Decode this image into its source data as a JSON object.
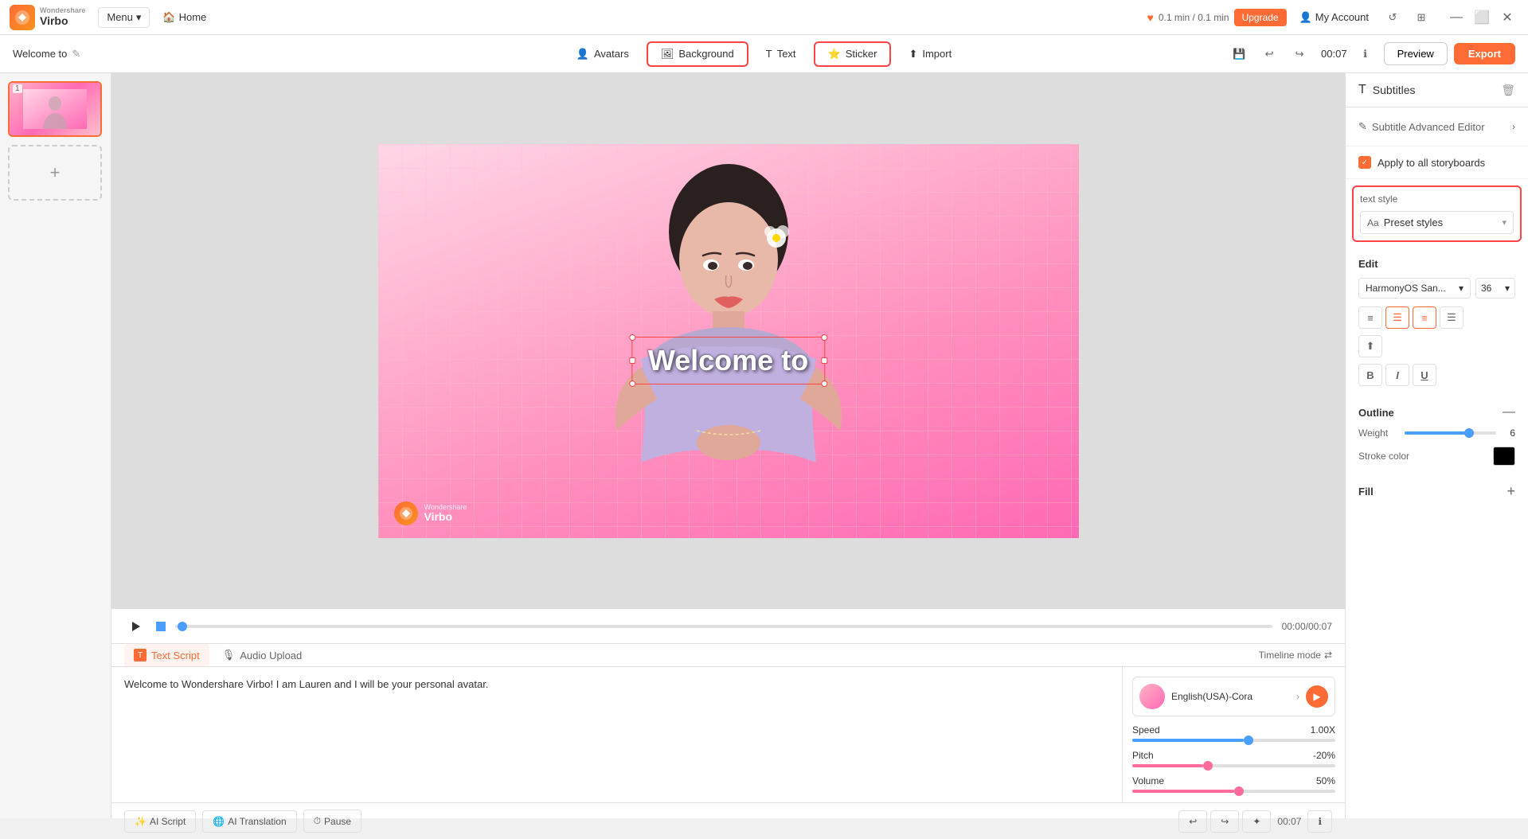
{
  "app": {
    "logo_text": "Virbo",
    "logo_brand": "Wondershare"
  },
  "topbar": {
    "menu_label": "Menu",
    "home_label": "Home",
    "timer_text": "0.1 min / 0.1 min",
    "upgrade_label": "Upgrade",
    "account_label": "My Account",
    "time_display": "00:07"
  },
  "page_title": "Welcome to",
  "toolbar": {
    "avatars_label": "Avatars",
    "background_label": "Background",
    "text_label": "Text",
    "sticker_label": "Sticker",
    "import_label": "Import",
    "preview_label": "Preview",
    "export_label": "Export"
  },
  "canvas": {
    "text_overlay": "Welcome to",
    "watermark_brand": "Wondershare",
    "watermark_product": "Virbo"
  },
  "playback": {
    "time": "00:00/00:07"
  },
  "script": {
    "text_script_label": "Text Script",
    "audio_upload_label": "Audio Upload",
    "timeline_mode_label": "Timeline mode",
    "content": "Welcome to Wondershare Virbo! I am Lauren and I will be your personal avatar.",
    "ai_script_label": "AI Script",
    "ai_translation_label": "AI Translation",
    "pause_label": "Pause",
    "time_display": "00:07",
    "voice": {
      "name": "English(USA)-Cora",
      "speed_label": "Speed",
      "speed_val": "1.00X",
      "pitch_label": "Pitch",
      "pitch_val": "-20%",
      "volume_label": "Volume",
      "volume_val": "50%",
      "speed_pct": 55,
      "pitch_pct": 35,
      "volume_pct": 50
    }
  },
  "right_panel": {
    "subtitles_label": "Subtitles",
    "advanced_editor_label": "Subtitle Advanced Editor",
    "apply_all_label": "Apply to all storyboards",
    "text_style_label": "text style",
    "preset_styles_label": "Preset styles",
    "edit_label": "Edit",
    "font_name": "HarmonyOS San...",
    "font_size": "36",
    "outline_label": "Outline",
    "weight_label": "Weight",
    "weight_val": "6",
    "stroke_color_label": "Stroke color",
    "fill_label": "Fill"
  }
}
